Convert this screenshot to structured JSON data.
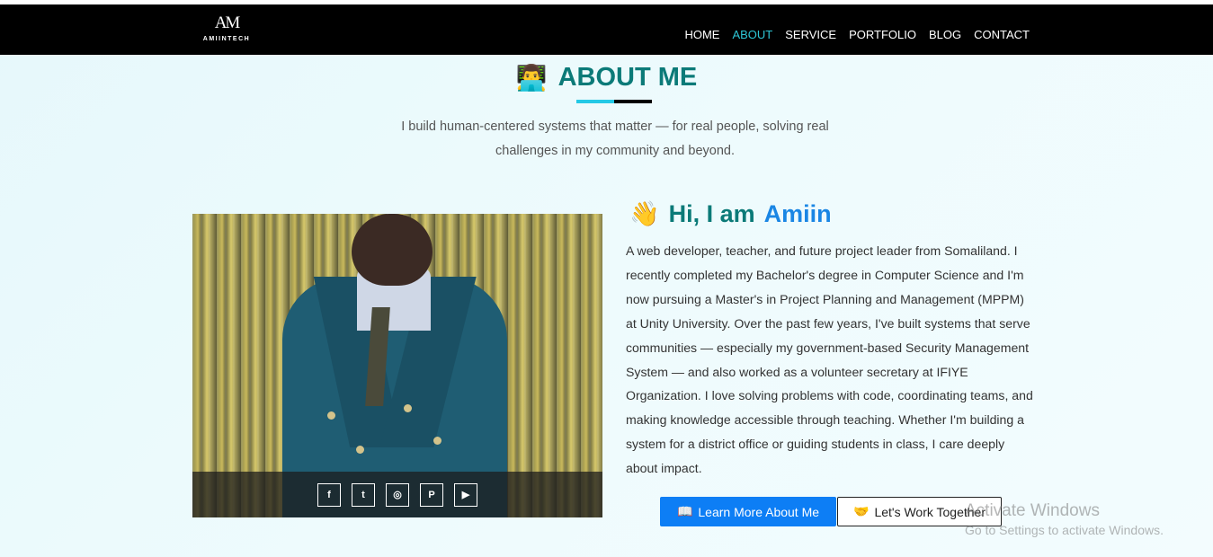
{
  "brand": {
    "logo_mark": "AM",
    "logo_text": "AMIINTECH"
  },
  "nav": {
    "items": [
      {
        "label": "HOME"
      },
      {
        "label": "ABOUT",
        "active": true
      },
      {
        "label": "SERVICE"
      },
      {
        "label": "PORTFOLIO"
      },
      {
        "label": "BLOG"
      },
      {
        "label": "CONTACT"
      }
    ],
    "active_color": "#2ec7d6"
  },
  "section": {
    "icon": "👨‍💻",
    "title": "ABOUT ME",
    "subtitle": "I build human-centered systems that matter — for real people, solving real challenges in my community and beyond."
  },
  "intro": {
    "wave_icon": "👋",
    "greeting": "Hi, I am",
    "name": "Amiin",
    "bio": "A web developer, teacher, and future project leader from Somaliland. I recently completed my Bachelor's degree in Computer Science and I'm now pursuing a Master's in Project Planning and Management (MPPM) at Unity University. Over the past few years, I've built systems that serve communities — especially my government-based Security Management System — and also worked as a volunteer secretary at IFIYE Organization. I love solving problems with code, coordinating teams, and making knowledge accessible through teaching. Whether I'm building a system for a district office or guiding students in class, I care deeply about impact."
  },
  "social": [
    {
      "icon": "facebook-icon",
      "glyph": "f"
    },
    {
      "icon": "twitter-icon",
      "glyph": "t"
    },
    {
      "icon": "instagram-icon",
      "glyph": "◎"
    },
    {
      "icon": "pinterest-icon",
      "glyph": "P"
    },
    {
      "icon": "youtube-icon",
      "glyph": "▶"
    }
  ],
  "buttons": {
    "learn_more": {
      "icon": "📖",
      "label": "Learn More About Me"
    },
    "work_together": {
      "icon": "🤝",
      "label": "Let's Work Together"
    }
  },
  "watermark": {
    "line1": "Activate Windows",
    "line2": "Go to Settings to activate Windows."
  },
  "colors": {
    "heading": "#0b7a78",
    "name_accent": "#1a86e4",
    "primary_button": "#0d7ef5",
    "underline_accent": "#24c9e6"
  }
}
